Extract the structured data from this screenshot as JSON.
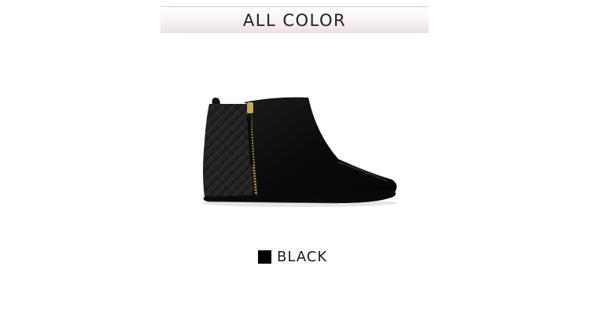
{
  "header": {
    "title": "ALL COLOR"
  },
  "product": {
    "image_icon": "ankle-boot-image",
    "color_name": "BLACK",
    "swatch_color": "#000000"
  }
}
